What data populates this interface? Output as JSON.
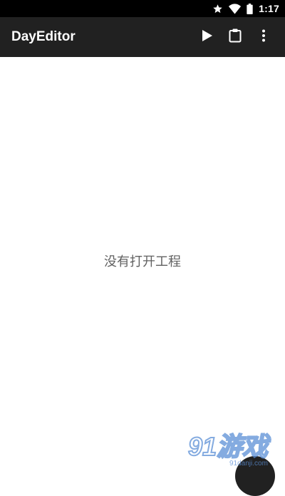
{
  "status_bar": {
    "time": "1:17",
    "icons": [
      "star-icon",
      "wifi-icon",
      "battery-icon"
    ]
  },
  "app_bar": {
    "title": "DayEditor",
    "actions": [
      {
        "name": "run",
        "icon": "play-icon"
      },
      {
        "name": "clipboard",
        "icon": "clipboard-icon"
      },
      {
        "name": "overflow",
        "icon": "more-vert-icon"
      }
    ]
  },
  "content": {
    "empty_message": "没有打开工程"
  },
  "watermark": {
    "text": "91游戏",
    "subtext": "91danji.com"
  },
  "colors": {
    "status_bar": "#000000",
    "app_bar": "#212121",
    "background": "#ffffff",
    "empty_text": "#616161",
    "watermark": "#5b8fd6"
  }
}
